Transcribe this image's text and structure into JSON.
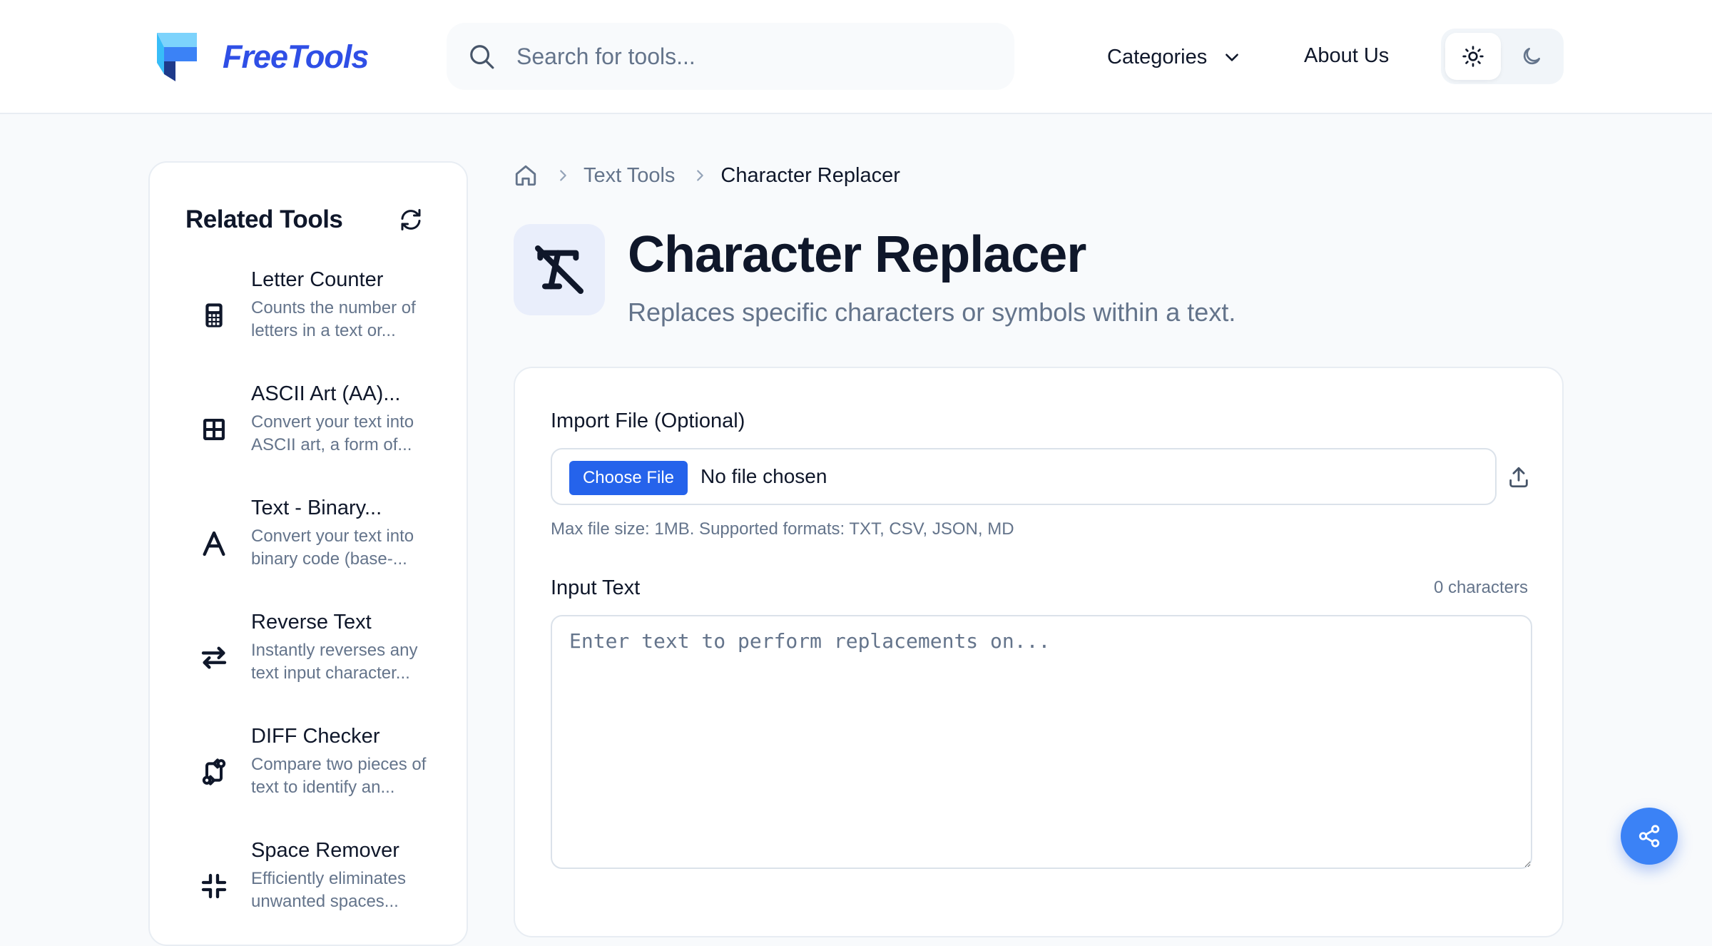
{
  "header": {
    "logo_text": "FreeTools",
    "search_placeholder": "Search for tools...",
    "nav_categories": "Categories",
    "nav_about": "About Us",
    "brand_color": "#2f4fe6"
  },
  "sidebar": {
    "title": "Related Tools",
    "items": [
      {
        "name": "Letter Counter",
        "desc": "Counts the number of letters in a text or...",
        "icon": "calculator-icon"
      },
      {
        "name": "ASCII Art (AA)...",
        "desc": "Convert your text into ASCII art, a form of...",
        "icon": "grid-icon"
      },
      {
        "name": "Text - Binary...",
        "desc": "Convert your text into binary code (base-...",
        "icon": "letter-a-icon"
      },
      {
        "name": "Reverse Text",
        "desc": "Instantly reverses any text input character...",
        "icon": "swap-arrows-icon"
      },
      {
        "name": "DIFF Checker",
        "desc": "Compare two pieces of text to identify an...",
        "icon": "git-compare-icon"
      },
      {
        "name": "Space Remover",
        "desc": "Efficiently eliminates unwanted spaces...",
        "icon": "minimize-icon"
      }
    ]
  },
  "breadcrumb": {
    "parent": "Text Tools",
    "current": "Character Replacer"
  },
  "page": {
    "title": "Character Replacer",
    "subtitle": "Replaces specific characters or symbols within a text.",
    "icon": "remove-formatting-icon"
  },
  "form": {
    "import_label": "Import File (Optional)",
    "choose_file": "Choose File",
    "file_status": "No file chosen",
    "file_hint": "Max file size: 1MB. Supported formats: TXT, CSV, JSON, MD",
    "input_label": "Input Text",
    "char_count": "0 characters",
    "input_value": "",
    "input_placeholder": "Enter text to perform replacements on..."
  },
  "colors": {
    "primary": "#2563eb",
    "fab": "#3b82f6",
    "muted_text": "#64748b"
  }
}
